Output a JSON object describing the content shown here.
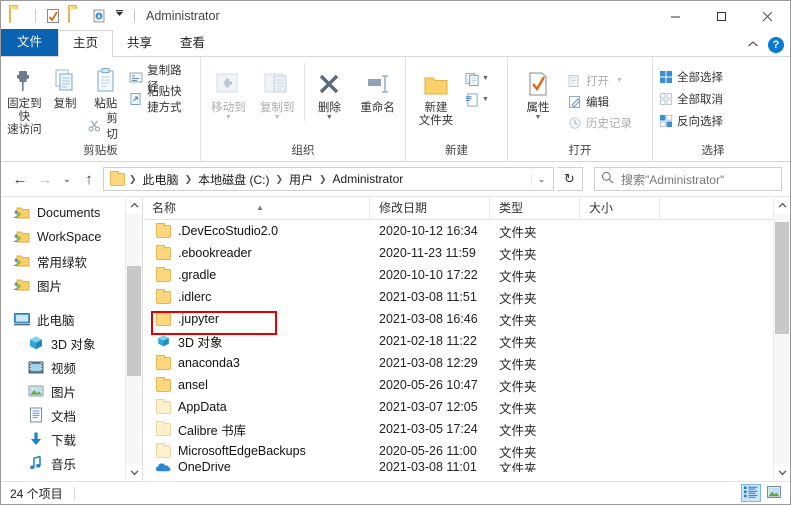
{
  "window": {
    "title": "Administrator",
    "quick_access_icons": [
      "folder-icon",
      "properties-icon",
      "new-folder-icon",
      "recycle-bin-icon",
      "customize-chevron-icon"
    ],
    "minimize_label": "—",
    "maximize_label": "☐",
    "close_label": "✕",
    "collapse_ribbon_label": "⌃",
    "help_label": "?"
  },
  "tabs": [
    {
      "label": "文件",
      "id": "file",
      "state": "file"
    },
    {
      "label": "主页",
      "id": "home",
      "state": "active"
    },
    {
      "label": "共享",
      "id": "share",
      "state": "normal"
    },
    {
      "label": "查看",
      "id": "view",
      "state": "normal"
    }
  ],
  "ribbon": {
    "groups": [
      {
        "name": "clipboard",
        "label": "剪贴板",
        "big": [
          {
            "label": "固定到快\n速访问",
            "line1": "固定到快",
            "line2": "速访问",
            "icon": "pin-icon",
            "dim": false
          },
          {
            "label": "复制",
            "line1": "复制",
            "line2": "",
            "icon": "copy-icon",
            "dim": false
          },
          {
            "label": "粘贴",
            "line1": "粘贴",
            "line2": "",
            "icon": "paste-icon",
            "dim": false
          }
        ],
        "small": [
          {
            "label": "复制路径",
            "icon": "copy-path-icon",
            "dim": false
          },
          {
            "label": "粘贴快捷方式",
            "icon": "paste-shortcut-icon",
            "dim": false
          }
        ],
        "cut": {
          "label": "剪切",
          "icon": "scissors-icon"
        }
      },
      {
        "name": "organize",
        "label": "组织",
        "big": [
          {
            "line1": "移动到",
            "line2": "",
            "icon": "move-to-icon",
            "dim": true,
            "caret": true
          },
          {
            "line1": "复制到",
            "line2": "",
            "icon": "copy-to-icon",
            "dim": true,
            "caret": true
          },
          {
            "line1": "删除",
            "line2": "",
            "icon": "delete-icon",
            "dim": false,
            "caret": true
          },
          {
            "line1": "重命名",
            "line2": "",
            "icon": "rename-icon",
            "dim": false,
            "caret": false
          }
        ]
      },
      {
        "name": "new",
        "label": "新建",
        "big": [
          {
            "line1": "新建",
            "line2": "文件夹",
            "icon": "new-folder-icon",
            "dim": false
          }
        ],
        "stack": [
          {
            "icon": "new-item-icon",
            "caret": true
          },
          {
            "icon": "easy-access-icon",
            "caret": true
          }
        ]
      },
      {
        "name": "open",
        "label": "打开",
        "big": [
          {
            "line1": "属性",
            "line2": "",
            "icon": "properties-icon",
            "dim": false,
            "caret": true
          }
        ],
        "small": [
          {
            "label": "打开",
            "icon": "open-icon",
            "dim": true,
            "caret": true
          },
          {
            "label": "编辑",
            "icon": "edit-icon",
            "dim": false
          },
          {
            "label": "历史记录",
            "icon": "history-icon",
            "dim": true
          }
        ]
      },
      {
        "name": "select",
        "label": "选择",
        "small": [
          {
            "label": "全部选择",
            "icon": "select-all-icon",
            "dim": false
          },
          {
            "label": "全部取消",
            "icon": "select-none-icon",
            "dim": false
          },
          {
            "label": "反向选择",
            "icon": "invert-selection-icon",
            "dim": false
          }
        ]
      }
    ]
  },
  "address": {
    "back_label": "←",
    "forward_label": "→",
    "recent_label": "⌄",
    "up_label": "↑",
    "breadcrumbs": [
      "此电脑",
      "本地磁盘 (C:)",
      "用户",
      "Administrator"
    ],
    "dropdown_label": "⌄",
    "refresh_label": "↻"
  },
  "search": {
    "placeholder": "搜索\"Administrator\"",
    "icon": "search-icon"
  },
  "sidebar": {
    "items": [
      {
        "label": "Documents",
        "icon": "shared-folder-icon",
        "level": 0
      },
      {
        "label": "WorkSpace",
        "icon": "shared-folder-icon",
        "level": 0
      },
      {
        "label": "常用绿软",
        "icon": "shared-folder-icon",
        "level": 0
      },
      {
        "label": "图片",
        "icon": "shared-folder-icon",
        "level": 0
      },
      {
        "label": "此电脑",
        "icon": "this-pc-icon",
        "level": 0,
        "gap_before": true
      },
      {
        "label": "3D 对象",
        "icon": "3d-objects-icon",
        "level": 1
      },
      {
        "label": "视频",
        "icon": "videos-icon",
        "level": 1
      },
      {
        "label": "图片",
        "icon": "pictures-icon",
        "level": 1
      },
      {
        "label": "文档",
        "icon": "documents-icon",
        "level": 1
      },
      {
        "label": "下载",
        "icon": "downloads-icon",
        "level": 1
      },
      {
        "label": "音乐",
        "icon": "music-icon",
        "level": 1
      }
    ]
  },
  "filelist": {
    "columns": [
      {
        "label": "名称",
        "key": "name",
        "sorted": true
      },
      {
        "label": "修改日期",
        "key": "date"
      },
      {
        "label": "类型",
        "key": "type"
      },
      {
        "label": "大小",
        "key": "size"
      }
    ],
    "rows": [
      {
        "name": ".DevEcoStudio2.0",
        "date": "2020-10-12 16:34",
        "type": "文件夹",
        "size": "",
        "icon": "folder-icon",
        "hidden": false
      },
      {
        "name": ".ebookreader",
        "date": "2020-11-23 11:59",
        "type": "文件夹",
        "size": "",
        "icon": "folder-icon",
        "hidden": false
      },
      {
        "name": ".gradle",
        "date": "2020-10-10 17:22",
        "type": "文件夹",
        "size": "",
        "icon": "folder-icon",
        "hidden": false
      },
      {
        "name": ".idlerc",
        "date": "2021-03-08 11:51",
        "type": "文件夹",
        "size": "",
        "icon": "folder-icon",
        "hidden": false
      },
      {
        "name": ".jupyter",
        "date": "2021-03-08 16:46",
        "type": "文件夹",
        "size": "",
        "icon": "folder-icon",
        "hidden": false,
        "highlight": true
      },
      {
        "name": "3D 对象",
        "date": "2021-02-18 11:22",
        "type": "文件夹",
        "size": "",
        "icon": "3d-objects-icon",
        "hidden": false
      },
      {
        "name": "anaconda3",
        "date": "2021-03-08 12:29",
        "type": "文件夹",
        "size": "",
        "icon": "folder-icon",
        "hidden": false
      },
      {
        "name": "ansel",
        "date": "2020-05-26 10:47",
        "type": "文件夹",
        "size": "",
        "icon": "folder-icon",
        "hidden": false
      },
      {
        "name": "AppData",
        "date": "2021-03-07 12:05",
        "type": "文件夹",
        "size": "",
        "icon": "folder-icon",
        "hidden": true
      },
      {
        "name": "Calibre 书库",
        "date": "2021-03-05 17:24",
        "type": "文件夹",
        "size": "",
        "icon": "folder-icon",
        "hidden": true
      },
      {
        "name": "MicrosoftEdgeBackups",
        "date": "2020-05-26 11:00",
        "type": "文件夹",
        "size": "",
        "icon": "folder-icon",
        "hidden": true
      },
      {
        "name": "OneDrive",
        "date": "2021-03-08 11:01",
        "type": "文件夹",
        "size": "",
        "icon": "onedrive-icon",
        "hidden": false,
        "clipped": true
      }
    ],
    "highlight_color": "#e60000"
  },
  "status": {
    "item_count": "24 个项目",
    "view_buttons": [
      {
        "name": "details-view-button",
        "icon": "details-view-icon",
        "selected": true
      },
      {
        "name": "large-icons-view-button",
        "icon": "large-icons-view-icon",
        "selected": false
      }
    ]
  }
}
